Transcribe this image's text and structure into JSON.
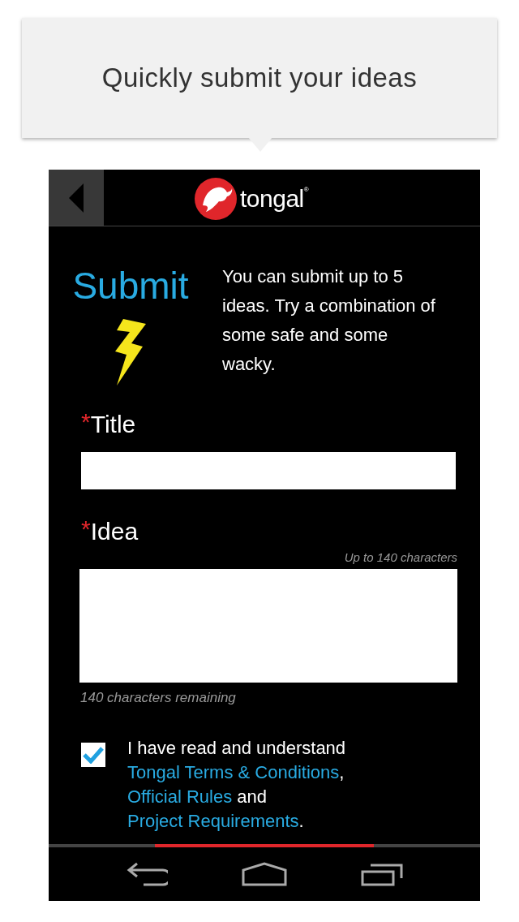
{
  "tooltip": {
    "text": "Quickly submit your ideas"
  },
  "header": {
    "logo_text": "tongal",
    "logo_mark": "®"
  },
  "intro": {
    "title": "Submit",
    "description": "You can submit up to 5 ideas. Try a combination of some safe and some wacky."
  },
  "fields": [
    {
      "kind": "line",
      "required_mark": "*",
      "label": "Title"
    },
    {
      "kind": "area",
      "required_mark": "*",
      "label": "Idea",
      "hint": "Up to 140 characters",
      "counter": "140 characters remaining"
    }
  ],
  "consent": {
    "checked": true,
    "parts": [
      {
        "kind": "text",
        "text": "I have read and understand "
      },
      {
        "kind": "link",
        "text": "Tongal Terms & Conditions"
      },
      {
        "kind": "text",
        "text": ", "
      },
      {
        "kind": "link",
        "text": "Official Rules"
      },
      {
        "kind": "text",
        "text": " and "
      },
      {
        "kind": "link",
        "text": "Project Requirements"
      },
      {
        "kind": "text",
        "text": "."
      }
    ]
  }
}
